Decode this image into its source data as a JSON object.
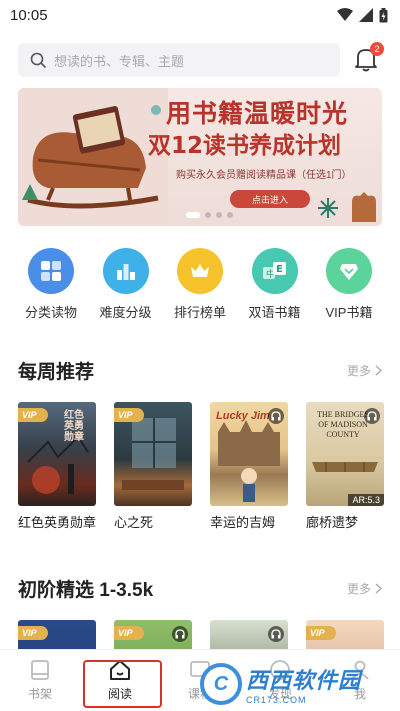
{
  "status_bar": {
    "time": "10:05"
  },
  "search": {
    "placeholder": "想读的书、专辑、主题"
  },
  "notifications": {
    "badge": "2"
  },
  "banner": {
    "title_line1": "用书籍温暖时光",
    "title_line2": "双12读书养成计划",
    "subtitle": "购买永久会员赠阅读精品课（任选1门）",
    "button": "点击进入",
    "slide_count": 5,
    "active_slide": 1
  },
  "categories": [
    {
      "label": "分类读物",
      "icon": "grid-icon",
      "color": "#4a8ee8"
    },
    {
      "label": "难度分级",
      "icon": "level-bars-icon",
      "color": "#3fb0e8"
    },
    {
      "label": "排行榜单",
      "icon": "crown-icon",
      "color": "#f6c32c"
    },
    {
      "label": "双语书籍",
      "icon": "bilingual-icon",
      "color": "#46c9b0"
    },
    {
      "label": "VIP书籍",
      "icon": "vip-diamond-icon",
      "color": "#5bd39a"
    }
  ],
  "weekly": {
    "title": "每周推荐",
    "more": "更多",
    "books": [
      {
        "title": "红色英勇勋章",
        "vip": "VIP",
        "audio": false,
        "ar": "",
        "cover_text": "红色英勇勋章"
      },
      {
        "title": "心之死",
        "vip": "VIP",
        "audio": false,
        "ar": "",
        "cover_text": ""
      },
      {
        "title": "幸运的吉姆",
        "vip": "",
        "audio": true,
        "ar": "",
        "cover_text": "Lucky Jim"
      },
      {
        "title": "廊桥遗梦",
        "vip": "",
        "audio": true,
        "ar": "AR:5.3",
        "cover_text": "THE BRIDGES OF MADISON COUNTY"
      }
    ]
  },
  "beginner": {
    "title": "初阶精选 1-3.5k",
    "more": "更多",
    "books": [
      {
        "vip": "VIP",
        "audio": false
      },
      {
        "vip": "VIP",
        "audio": true
      },
      {
        "vip": "",
        "audio": true
      },
      {
        "vip": "VIP",
        "audio": false
      }
    ]
  },
  "bottom_nav": [
    {
      "label": "书架",
      "icon": "bookshelf-icon"
    },
    {
      "label": "阅读",
      "icon": "home-icon"
    },
    {
      "label": "课程",
      "icon": "course-icon"
    },
    {
      "label": "发现",
      "icon": "discover-icon"
    },
    {
      "label": "我",
      "icon": "profile-icon"
    }
  ],
  "watermark": {
    "main": "西西软件园",
    "sub": "CR173.COM"
  }
}
